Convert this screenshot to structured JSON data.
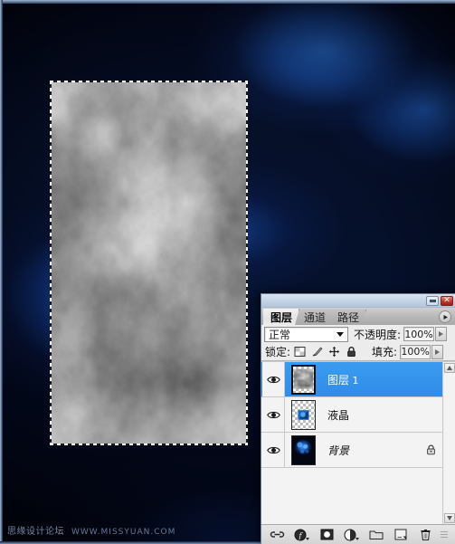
{
  "document": {
    "app": "Adobe Photoshop",
    "canvas_description": "Render Clouds grayscale texture with active rectangular selection (marching ants)",
    "background_description": "Dark navy blue backdrop with bright blue radial light glows"
  },
  "watermark": {
    "chinese": "思缘设计论坛",
    "english": "WWW.MISSYUAN.COM"
  },
  "panel": {
    "titlebar": {
      "minimize_label": "—",
      "close_label": "✕",
      "minimize_icon": "minimize-icon",
      "close_icon": "close-icon"
    },
    "tabs": [
      {
        "label": "图层",
        "active": true
      },
      {
        "label": "通道",
        "active": false
      },
      {
        "label": "路径",
        "active": false
      }
    ],
    "menu_icon": "panel-menu-icon",
    "blend": {
      "mode_value": "正常",
      "opacity_label": "不透明度:",
      "opacity_value": "100%"
    },
    "lock": {
      "label": "锁定:",
      "icons": [
        {
          "name": "lock-transparent-pixels-icon",
          "title": "锁定透明像素"
        },
        {
          "name": "lock-image-pixels-icon",
          "title": "锁定图像像素"
        },
        {
          "name": "lock-position-icon",
          "title": "锁定位置"
        },
        {
          "name": "lock-all-icon",
          "title": "锁定全部"
        }
      ],
      "fill_label": "填充:",
      "fill_value": "100%"
    },
    "layers": [
      {
        "name": "图层",
        "suffix": " 1",
        "visible": true,
        "selected": true,
        "locked": false,
        "thumb": "clouds-gray-transparent"
      },
      {
        "name": "液晶",
        "suffix": "",
        "visible": true,
        "selected": false,
        "locked": false,
        "thumb": "blue-shape-transparent"
      },
      {
        "name": "背景",
        "suffix": "",
        "visible": true,
        "selected": false,
        "locked": true,
        "thumb": "blue-glow-background"
      }
    ],
    "bottom_tools": [
      {
        "name": "link-layers-icon",
        "label": "链接图层"
      },
      {
        "name": "layer-style-fx-icon",
        "label": "添加图层样式"
      },
      {
        "name": "add-layer-mask-icon",
        "label": "添加图层蒙版"
      },
      {
        "name": "new-adjustment-layer-icon",
        "label": "创建新的填充或调整图层"
      },
      {
        "name": "new-group-icon",
        "label": "创建新组"
      },
      {
        "name": "new-layer-icon",
        "label": "创建新图层"
      },
      {
        "name": "delete-layer-icon",
        "label": "删除图层"
      }
    ],
    "scrollbar": {
      "up_icon": "scroll-up-arrow-icon",
      "down_icon": "scroll-down-arrow-icon"
    }
  },
  "colors": {
    "selection_blue": "#2f8ce8",
    "panel_bg": "#ebebeb",
    "backdrop_navy": "#05102b",
    "glow_blue": "#2a76e0",
    "close_red": "#c0352b"
  }
}
